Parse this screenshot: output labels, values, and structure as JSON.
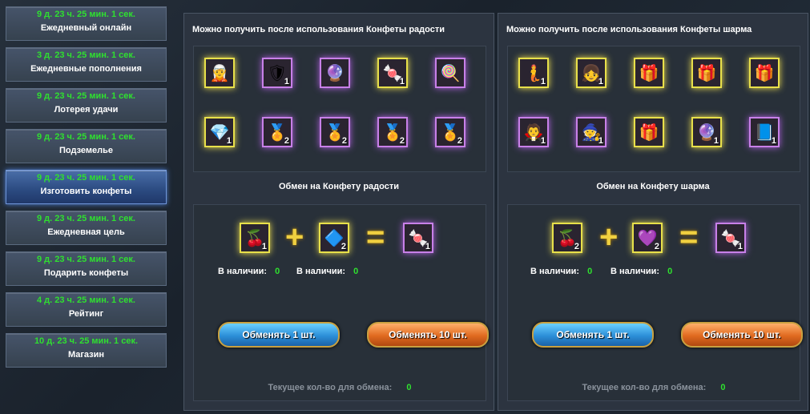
{
  "sidebar": {
    "items": [
      {
        "timer": "9 д. 23 ч. 25 мин. 1 сек.",
        "label": "Ежедневный онлайн"
      },
      {
        "timer": "3 д. 23 ч. 25 мин. 1 сек.",
        "label": "Ежедневные пополнения"
      },
      {
        "timer": "9 д. 23 ч. 25 мин. 1 сек.",
        "label": "Лотерея удачи"
      },
      {
        "timer": "9 д. 23 ч. 25 мин. 1 сек.",
        "label": "Подземелье"
      },
      {
        "timer": "9 д. 23 ч. 25 мин. 1 сек.",
        "label": "Изготовить конфеты"
      },
      {
        "timer": "9 д. 23 ч. 25 мин. 1 сек.",
        "label": "Ежедневная цель"
      },
      {
        "timer": "9 д. 23 ч. 25 мин. 1 сек.",
        "label": "Подарить конфеты"
      },
      {
        "timer": "4 д. 23 ч. 25 мин. 1 сек.",
        "label": "Рейтинг"
      },
      {
        "timer": "10 д. 23 ч. 25 мин. 1 сек.",
        "label": "Магазин"
      }
    ]
  },
  "left": {
    "title": "Можно получить после использования Конфеты радости",
    "exchange_title": "Обмен на Конфету радости",
    "in_stock_label": "В наличии:",
    "stock_a": "0",
    "stock_b": "0",
    "ingredient_a_count": "1",
    "ingredient_b_count": "2",
    "result_count": "1",
    "btn_1": "Обменять 1 шт.",
    "btn_10": "Обменять 10 шт.",
    "current_label": "Текущее кол-во для обмена:",
    "current_value": "0",
    "rewards_counts": [
      "",
      "1",
      "",
      "1",
      "",
      "1",
      "2",
      "2",
      "2",
      "2"
    ]
  },
  "right": {
    "title": "Можно получить после использования Конфеты шарма",
    "exchange_title": "Обмен на Конфету шарма",
    "in_stock_label": "В наличии:",
    "stock_a": "0",
    "stock_b": "0",
    "ingredient_a_count": "2",
    "ingredient_b_count": "2",
    "result_count": "1",
    "btn_1": "Обменять 1 шт.",
    "btn_10": "Обменять 10 шт.",
    "current_label": "Текущее кол-во для обмена:",
    "current_value": "0",
    "rewards_counts": [
      "1",
      "1",
      "",
      "",
      "",
      "1",
      "1",
      "",
      "1",
      "1"
    ]
  },
  "ops": {
    "plus": "+",
    "equals": "="
  }
}
